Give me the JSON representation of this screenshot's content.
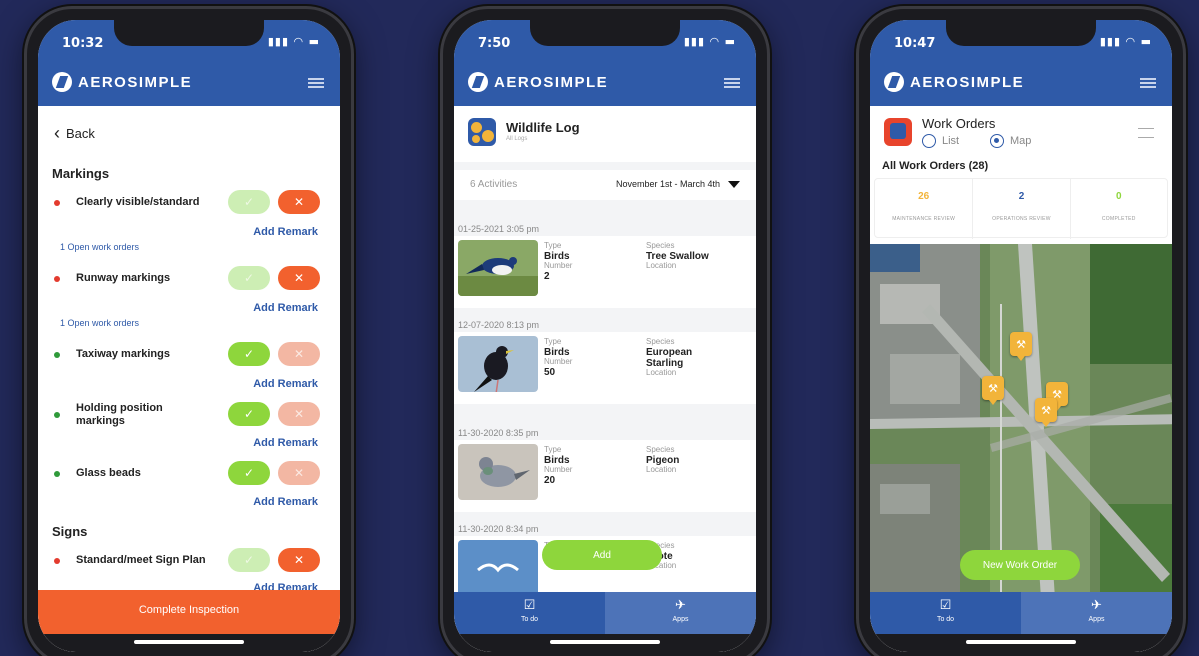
{
  "brand": "AEROSIMPLE",
  "colors": {
    "background": "#22295a",
    "app_blue": "#2f5aa8",
    "accent_green": "#8ed63c",
    "accent_orange": "#f2612e",
    "map_pin": "#f2b43a"
  },
  "phone1": {
    "time": "10:32",
    "back_label": "Back",
    "sections": [
      {
        "title": "Markings"
      },
      {
        "title": "Signs"
      }
    ],
    "items": [
      {
        "label": "Clearly visible/standard",
        "status": "red",
        "open_orders": "1 Open work orders",
        "remark": "Add Remark"
      },
      {
        "label": "Runway markings",
        "status": "red",
        "open_orders": "1 Open work orders",
        "remark": "Add Remark"
      },
      {
        "label": "Taxiway markings",
        "status": "green",
        "remark": "Add Remark"
      },
      {
        "label": "Holding position markings",
        "status": "green",
        "remark": "Add Remark"
      },
      {
        "label": "Glass beads",
        "status": "green",
        "remark": "Add Remark"
      },
      {
        "label": "Standard/meet Sign Plan",
        "status": "red",
        "remark": "Add Remark"
      }
    ],
    "complete_button": "Complete Inspection"
  },
  "phone2": {
    "time": "7:50",
    "app_title": "Wildlife Log",
    "app_subtitle": "All Logs",
    "activities": "6 Activities",
    "date_range": "November 1st - March 4th",
    "labels": {
      "type": "Type",
      "number": "Number",
      "species": "Species",
      "location": "Location"
    },
    "entries": [
      {
        "date": "01-25-2021 3:05 pm",
        "type": "Birds",
        "number": "2",
        "species": "Tree Swallow"
      },
      {
        "date": "12-07-2020 8:13 pm",
        "type": "Birds",
        "number": "50",
        "species": "European Starling"
      },
      {
        "date": "11-30-2020 8:35 pm",
        "type": "Birds",
        "number": "20",
        "species": "Pigeon"
      },
      {
        "date": "11-30-2020 8:34 pm",
        "type": "",
        "number": "",
        "species": "oyote"
      }
    ],
    "add_button": "Add",
    "tabs": {
      "todo": "To do",
      "apps": "Apps"
    }
  },
  "phone3": {
    "time": "10:47",
    "app_title": "Work Orders",
    "view_list": "List",
    "view_map": "Map",
    "all_orders": "All Work Orders (28)",
    "stats": [
      {
        "value": "26",
        "label": "MAINTENANCE REVIEW",
        "color": "#f2b43a"
      },
      {
        "value": "2",
        "label": "OPERATIONS REVIEW",
        "color": "#2f5aa8"
      },
      {
        "value": "0",
        "label": "COMPLETED",
        "color": "#8ed63c"
      }
    ],
    "new_order_button": "New Work Order",
    "tabs": {
      "todo": "To do",
      "apps": "Apps"
    }
  }
}
